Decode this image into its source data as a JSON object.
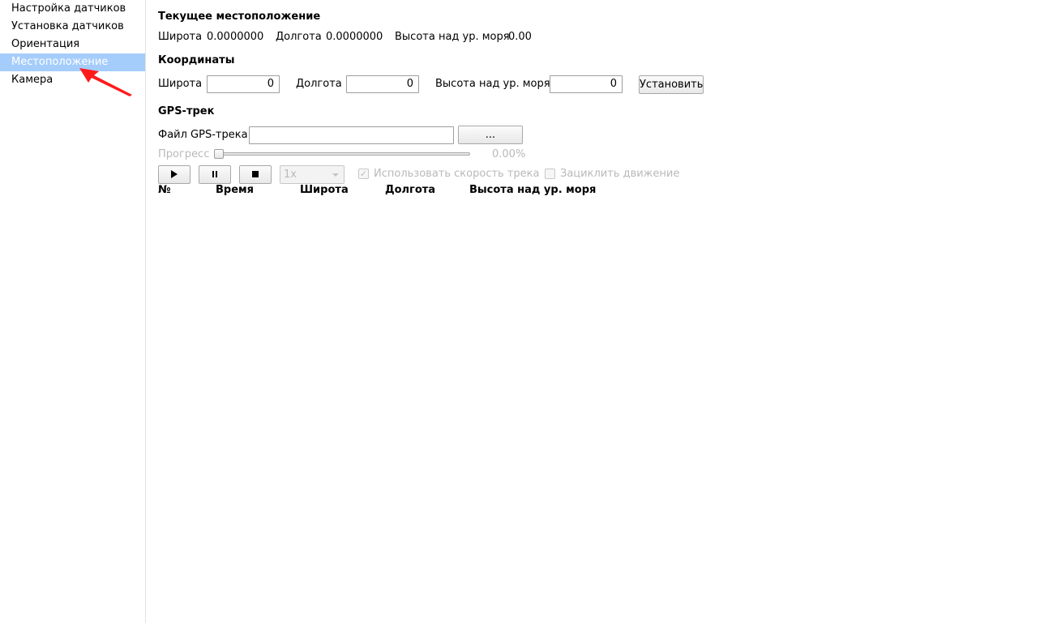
{
  "sidebar": {
    "items": [
      {
        "label": "Настройка датчиков"
      },
      {
        "label": "Установка датчиков"
      },
      {
        "label": "Ориентация"
      },
      {
        "label": "Местоположение"
      },
      {
        "label": "Камера"
      }
    ],
    "active_index": 3
  },
  "current_location": {
    "heading": "Текущее местоположение",
    "latitude_label": "Широта",
    "latitude_value": "0.0000000",
    "longitude_label": "Долгота",
    "longitude_value": "0.0000000",
    "altitude_label": "Высота над ур. моря",
    "altitude_value": "0.00"
  },
  "coordinates": {
    "heading": "Координаты",
    "latitude_label": "Широта",
    "latitude_value": "0",
    "longitude_label": "Долгота",
    "longitude_value": "0",
    "altitude_label": "Высота над ур. моря",
    "altitude_value": "0",
    "set_button": "Установить"
  },
  "gps_track": {
    "heading": "GPS-трек",
    "file_label": "Файл GPS-трека",
    "file_value": "",
    "browse_button": "...",
    "progress_label": "Прогресс",
    "progress_value": 0.0,
    "progress_text": "0.00%",
    "speed_value": "1x",
    "use_track_speed_label": "Использовать скорость трека",
    "use_track_speed_checked": true,
    "loop_label": "Зациклить движение",
    "loop_checked": false,
    "columns": [
      "№",
      "Время",
      "Широта",
      "Долгота",
      "Высота над ур. моря"
    ]
  },
  "icons": {
    "play": "play-icon",
    "pause": "pause-icon",
    "stop": "stop-icon",
    "annotation": "red-arrow-annotation"
  },
  "colors": {
    "selection": "#a5cdfb",
    "annotation_arrow": "#ff1a1a",
    "disabled_text": "#b9b9b9"
  }
}
